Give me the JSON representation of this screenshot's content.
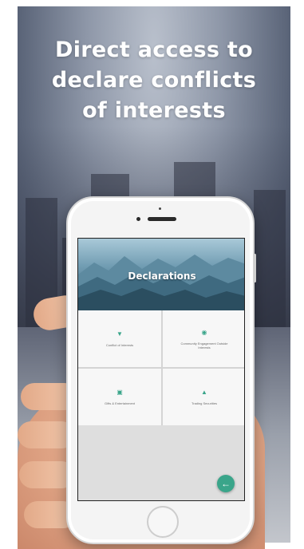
{
  "headline": {
    "line1": "Direct access to",
    "line2": "declare conflicts",
    "line3": "of interests"
  },
  "app": {
    "title": "Declarations",
    "tiles": [
      {
        "label": "Conflict of Interests",
        "icon": "shield-icon"
      },
      {
        "label": "Community Engagement Outside Interests",
        "icon": "people-icon"
      },
      {
        "label": "Gifts & Entertainment",
        "icon": "gift-icon"
      },
      {
        "label": "Trading Securities",
        "icon": "chart-icon"
      }
    ],
    "fab_icon": "back-arrow-icon",
    "accent_color": "#3aa58a"
  }
}
